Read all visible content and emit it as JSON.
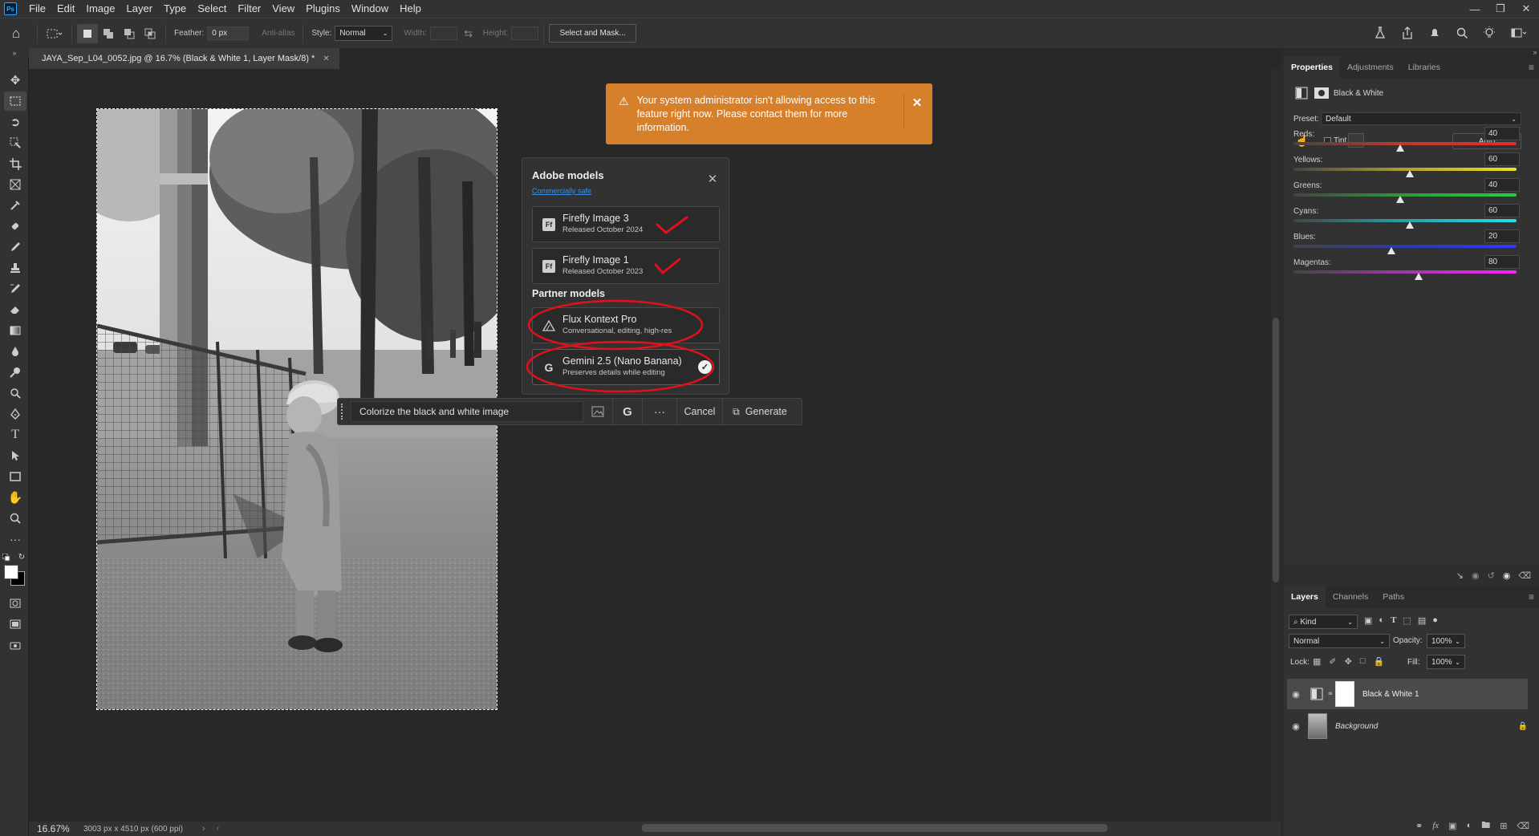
{
  "menubar": {
    "logo": "Ps",
    "items": [
      "File",
      "Edit",
      "Image",
      "Layer",
      "Type",
      "Select",
      "Filter",
      "View",
      "Plugins",
      "Window",
      "Help"
    ]
  },
  "options": {
    "feather_label": "Feather:",
    "feather_value": "0 px",
    "antialias_label": "Anti-alias",
    "style_label": "Style:",
    "style_value": "Normal",
    "width_label": "Width:",
    "height_label": "Height:",
    "select_mask_label": "Select and Mask..."
  },
  "document": {
    "tab_title": "JAYA_Sep_L04_0052.jpg @ 16.7% (Black & White 1, Layer Mask/8) *",
    "zoom": "16.67%",
    "info": "3003 px x 4510 px (600 ppi)"
  },
  "toast": {
    "message": "Your system administrator isn't allowing access to this feature right now. Please contact them for more information."
  },
  "models_popup": {
    "title": "Adobe models",
    "subtitle_link": "Commercially safe",
    "adobe_models": [
      {
        "name": "Firefly Image 3",
        "sub": "Released October 2024",
        "icon": "Ff"
      },
      {
        "name": "Firefly Image 1",
        "sub": "Released October 2023",
        "icon": "Ff"
      }
    ],
    "partner_heading": "Partner models",
    "partner_models": [
      {
        "name": "Flux Kontext Pro",
        "sub": "Conversational, editing, high-res"
      },
      {
        "name": "Gemini 2.5 (Nano Banana)",
        "sub": "Preserves details while editing"
      }
    ]
  },
  "prompt_bar": {
    "input_value": "Colorize the black and white image",
    "model_glyph": "G",
    "more_label": "···",
    "cancel_label": "Cancel",
    "generate_label": "Generate"
  },
  "properties": {
    "tabs": [
      "Properties",
      "Adjustments",
      "Libraries"
    ],
    "adjustment_title": "Black & White",
    "preset_label": "Preset:",
    "preset_value": "Default",
    "tint_label": "Tint",
    "auto_label": "Auto",
    "sliders": [
      {
        "label": "Reds:",
        "value": "40",
        "fraction": 0.48
      },
      {
        "label": "Yellows:",
        "value": "60",
        "fraction": 0.52
      },
      {
        "label": "Greens:",
        "value": "40",
        "fraction": 0.48
      },
      {
        "label": "Cyans:",
        "value": "60",
        "fraction": 0.52
      },
      {
        "label": "Blues:",
        "value": "20",
        "fraction": 0.44
      },
      {
        "label": "Magentas:",
        "value": "80",
        "fraction": 0.56
      }
    ]
  },
  "layers": {
    "tabs": [
      "Layers",
      "Channels",
      "Paths"
    ],
    "kind_label": "Kind",
    "blend_mode": "Normal",
    "opacity_label": "Opacity:",
    "opacity_value": "100%",
    "lock_label": "Lock:",
    "fill_label": "Fill:",
    "fill_value": "100%",
    "items": [
      {
        "name": "Black & White 1"
      },
      {
        "name": "Background"
      }
    ]
  },
  "colors": {
    "toast_bg": "#d7802c",
    "annotation_red": "#e0111b",
    "link_blue": "#3d8fe0"
  }
}
